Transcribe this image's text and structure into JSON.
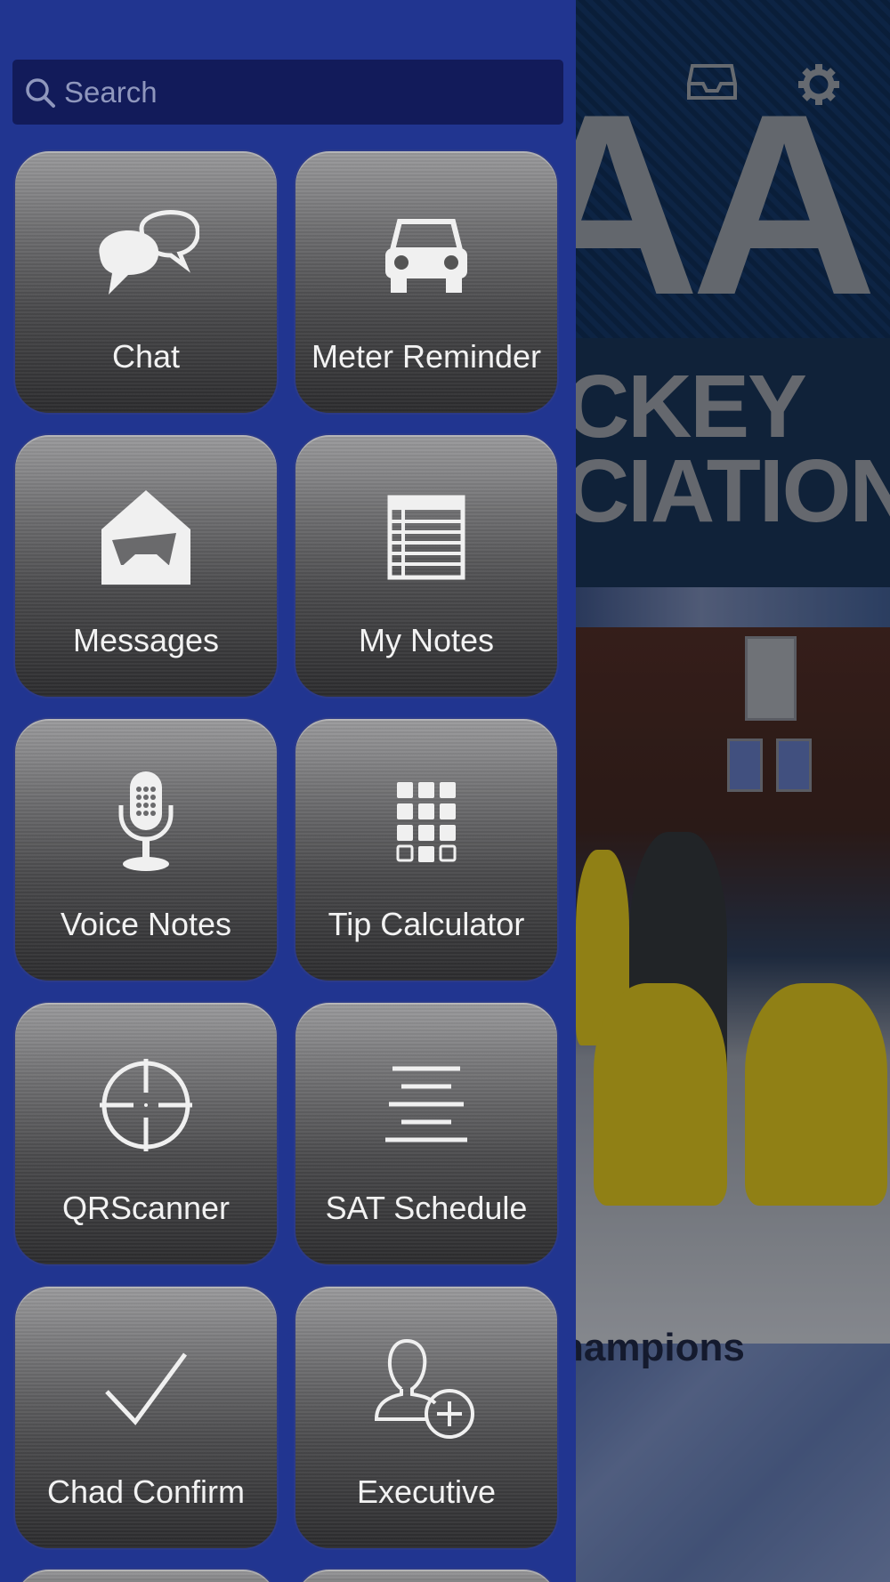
{
  "search": {
    "placeholder": "Search"
  },
  "tiles": [
    {
      "label": "Chat",
      "icon": "chat-bubbles-icon"
    },
    {
      "label": "Meter Reminder",
      "icon": "car-icon"
    },
    {
      "label": "Messages",
      "icon": "envelope-open-icon"
    },
    {
      "label": "My Notes",
      "icon": "notes-list-icon"
    },
    {
      "label": "Voice Notes",
      "icon": "microphone-icon"
    },
    {
      "label": "Tip Calculator",
      "icon": "keypad-icon"
    },
    {
      "label": "QRScanner",
      "icon": "crosshair-icon"
    },
    {
      "label": "SAT Schedule",
      "icon": "align-center-icon"
    },
    {
      "label": "Chad Confirm",
      "icon": "checkmark-icon"
    },
    {
      "label": "Executive",
      "icon": "add-user-icon"
    }
  ],
  "background": {
    "logo_fragment": "AA",
    "title_line1": "CKEY",
    "title_line2": "CIATION",
    "caption": "hampions",
    "header_icons": [
      "inbox-icon",
      "gear-icon"
    ]
  },
  "colors": {
    "drawer": "#213590",
    "search_bar": "#121b5a",
    "tile_text": "#f2f2f2"
  }
}
